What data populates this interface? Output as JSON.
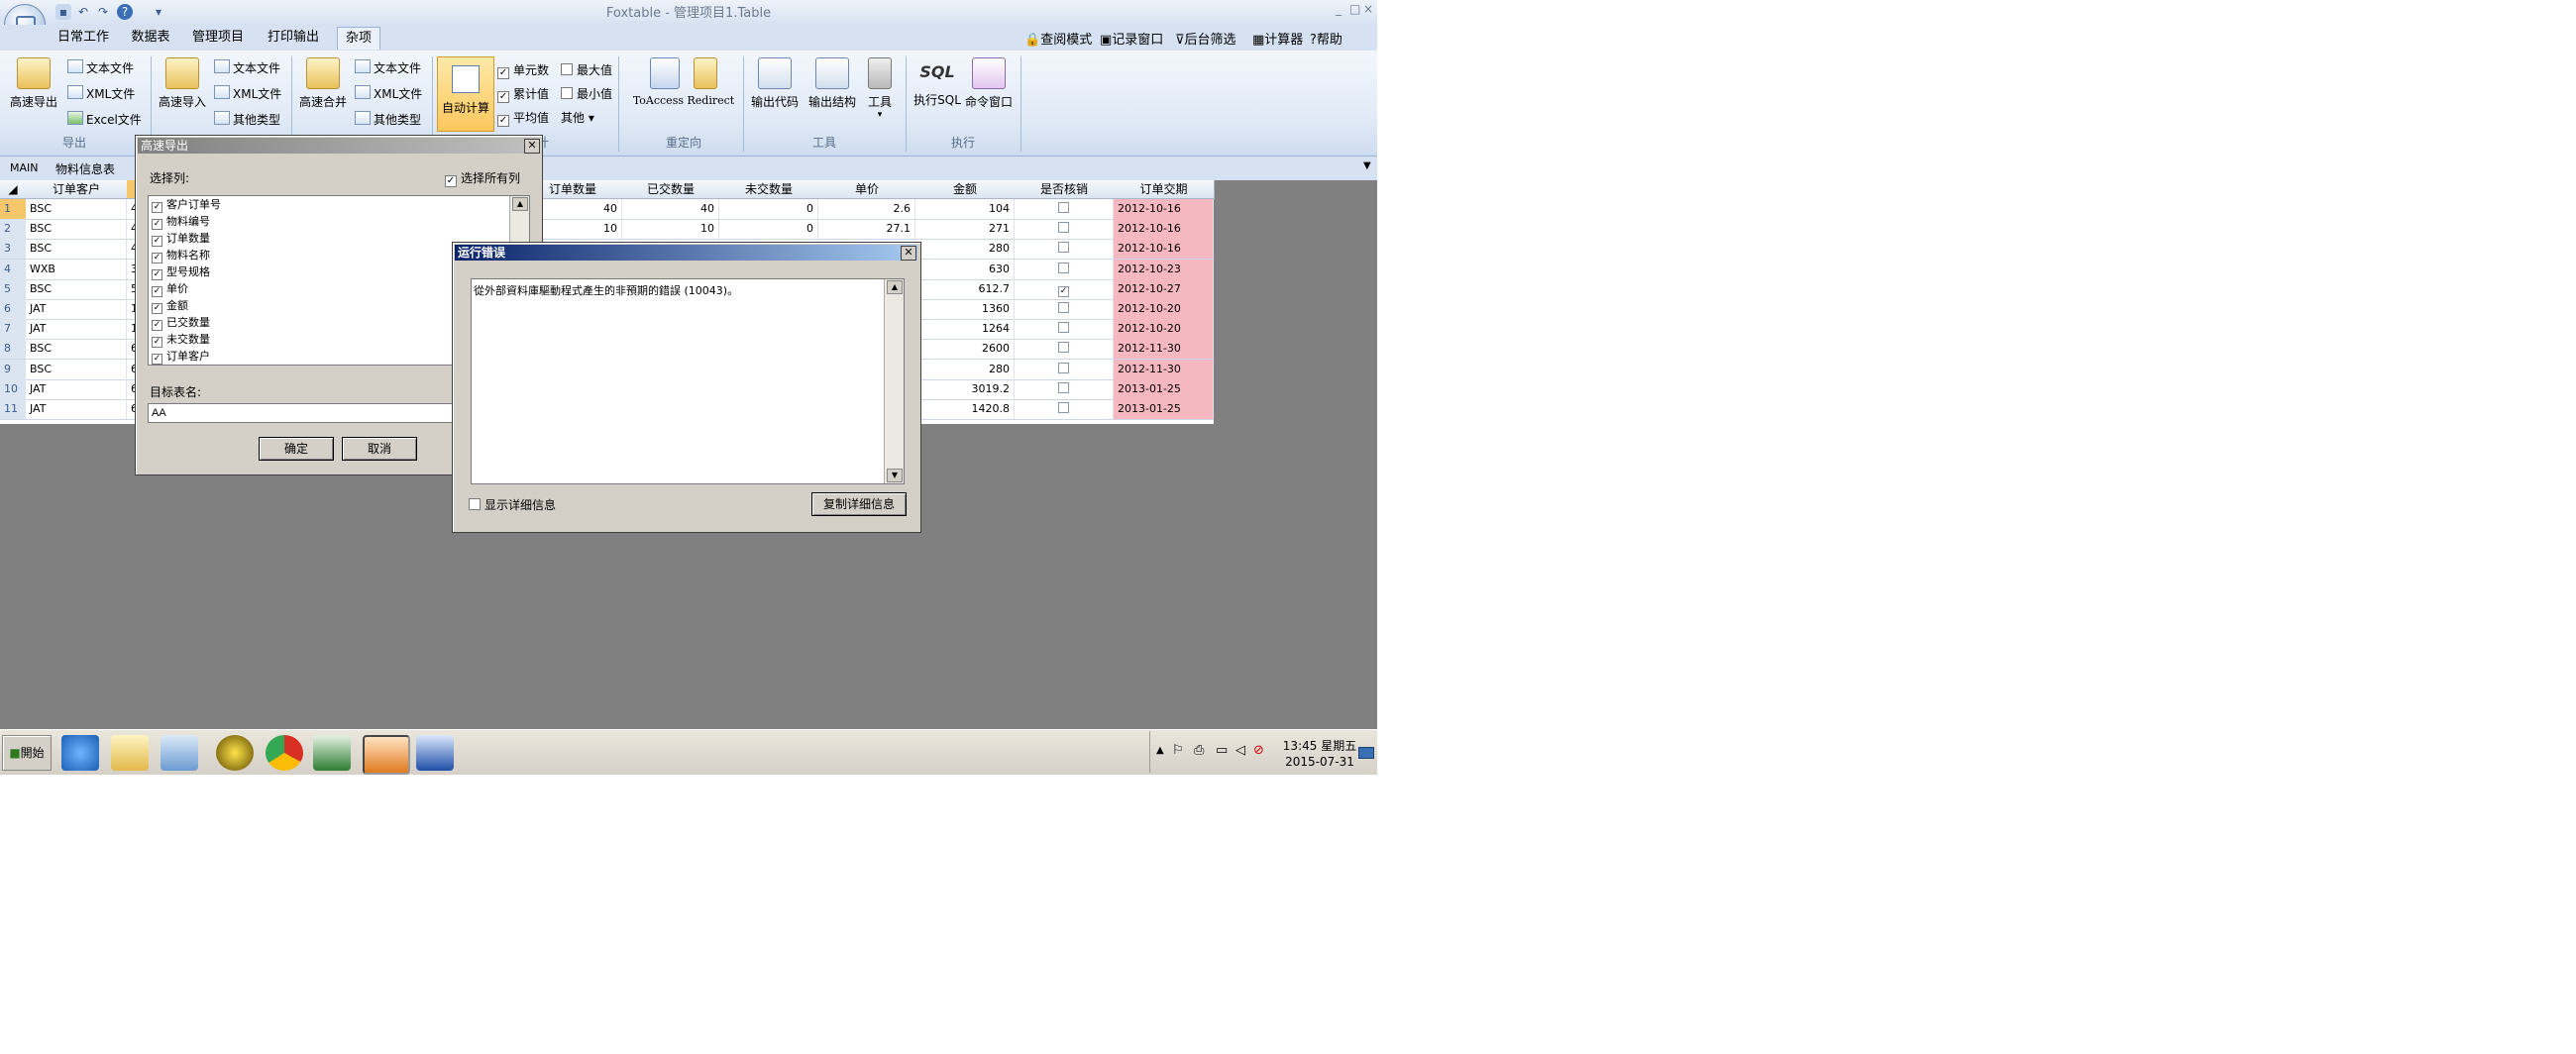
{
  "window": {
    "title": "Foxtable - 管理项目1.Table",
    "min": "_",
    "max": "□",
    "close": "×"
  },
  "menu": {
    "tabs": [
      "日常工作",
      "数据表",
      "管理项目",
      "打印输出",
      "杂项"
    ],
    "right_tools": [
      "查阅模式",
      "记录窗口",
      "后台筛选",
      "计算器",
      "帮助"
    ]
  },
  "ribbon": {
    "export": {
      "big": "高速导出",
      "items": [
        "文本文件",
        "XML文件",
        "Excel文件"
      ],
      "label": "导出"
    },
    "import": {
      "big": "高速导入",
      "items": [
        "文本文件",
        "XML文件",
        "其他类型"
      ]
    },
    "merge": {
      "big": "高速合并",
      "items": [
        "文本文件",
        "XML文件",
        "其他类型"
      ]
    },
    "autocalc": "自动计算",
    "stats": {
      "col1": [
        "单元数",
        "累计值",
        "平均值"
      ],
      "col2": [
        "最大值",
        "最小值",
        "其他"
      ],
      "label": "计"
    },
    "redirect": {
      "big": "ToAccess Redirect",
      "label": "重定向"
    },
    "tools": {
      "items": [
        "输出代码",
        "输出结构",
        "工具"
      ],
      "label": "工具"
    },
    "exec": {
      "items": [
        "执行SQL",
        "命令窗口"
      ],
      "label": "执行",
      "sql": "SQL"
    }
  },
  "docbar": {
    "tabs": [
      "MAIN",
      "物料信息表"
    ]
  },
  "grid": {
    "headers": [
      "订单客户",
      "订单数量",
      "已交数量",
      "未交数量",
      "单价",
      "金额",
      "是否核销",
      "订单交期"
    ],
    "rows": [
      {
        "n": "1",
        "c": "BSC",
        "p": "4",
        "q": "40",
        "d": "40",
        "u": "0",
        "price": "2.6",
        "amt": "104",
        "chk": false,
        "date": "2012-10-16"
      },
      {
        "n": "2",
        "c": "BSC",
        "p": "4",
        "q": "10",
        "d": "10",
        "u": "0",
        "price": "27.1",
        "amt": "271",
        "chk": false,
        "date": "2012-10-16"
      },
      {
        "n": "3",
        "c": "BSC",
        "p": "4",
        "q": "",
        "d": "",
        "u": "",
        "price": "",
        "amt": "280",
        "chk": false,
        "date": "2012-10-16"
      },
      {
        "n": "4",
        "c": "WXB",
        "p": "3",
        "q": "",
        "d": "",
        "u": "",
        "price": "",
        "amt": "630",
        "chk": false,
        "date": "2012-10-23"
      },
      {
        "n": "5",
        "c": "BSC",
        "p": "5",
        "q": "",
        "d": "",
        "u": "",
        "price": "",
        "amt": "612.7",
        "chk": true,
        "date": "2012-10-27"
      },
      {
        "n": "6",
        "c": "JAT",
        "p": "1",
        "q": "",
        "d": "",
        "u": "",
        "price": "",
        "amt": "1360",
        "chk": false,
        "date": "2012-10-20"
      },
      {
        "n": "7",
        "c": "JAT",
        "p": "1",
        "q": "",
        "d": "",
        "u": "",
        "price": "",
        "amt": "1264",
        "chk": false,
        "date": "2012-10-20"
      },
      {
        "n": "8",
        "c": "BSC",
        "p": "6",
        "q": "",
        "d": "",
        "u": "",
        "price": "",
        "amt": "2600",
        "chk": false,
        "date": "2012-11-30"
      },
      {
        "n": "9",
        "c": "BSC",
        "p": "6",
        "q": "",
        "d": "",
        "u": "",
        "price": "",
        "amt": "280",
        "chk": false,
        "date": "2012-11-30"
      },
      {
        "n": "10",
        "c": "JAT",
        "p": "6",
        "q": "",
        "d": "",
        "u": "",
        "price": "",
        "amt": "3019.2",
        "chk": false,
        "date": "2013-01-25"
      },
      {
        "n": "11",
        "c": "JAT",
        "p": "6",
        "q": "",
        "d": "",
        "u": "",
        "price": "",
        "amt": "1420.8",
        "chk": false,
        "date": "2013-01-25"
      }
    ]
  },
  "export_dialog": {
    "title": "高速导出",
    "select_label": "选择列:",
    "select_all": "选择所有列",
    "columns": [
      "客户订单号",
      "物料编号",
      "订单数量",
      "物料名称",
      "型号规格",
      "单价",
      "金额",
      "已交数量",
      "未交数量",
      "订单客户"
    ],
    "target_label": "目标表名:",
    "target_value": "AA",
    "ok": "确定",
    "cancel": "取消"
  },
  "error_dialog": {
    "title": "运行错误",
    "message": "從外部資料庫驅動程式產生的非預期的錯誤 (10043)。",
    "show_details": "显示详细信息",
    "copy_details": "复制详细信息"
  },
  "taskbar": {
    "start": "開始",
    "clock_time": "13:45 星期五",
    "clock_date": "2015-07-31"
  },
  "colors": {
    "ribbon": "#dfe9f6",
    "date_cell": "#f6b8c0",
    "dialog_title": "#0a246a",
    "workspace": "#808080"
  }
}
